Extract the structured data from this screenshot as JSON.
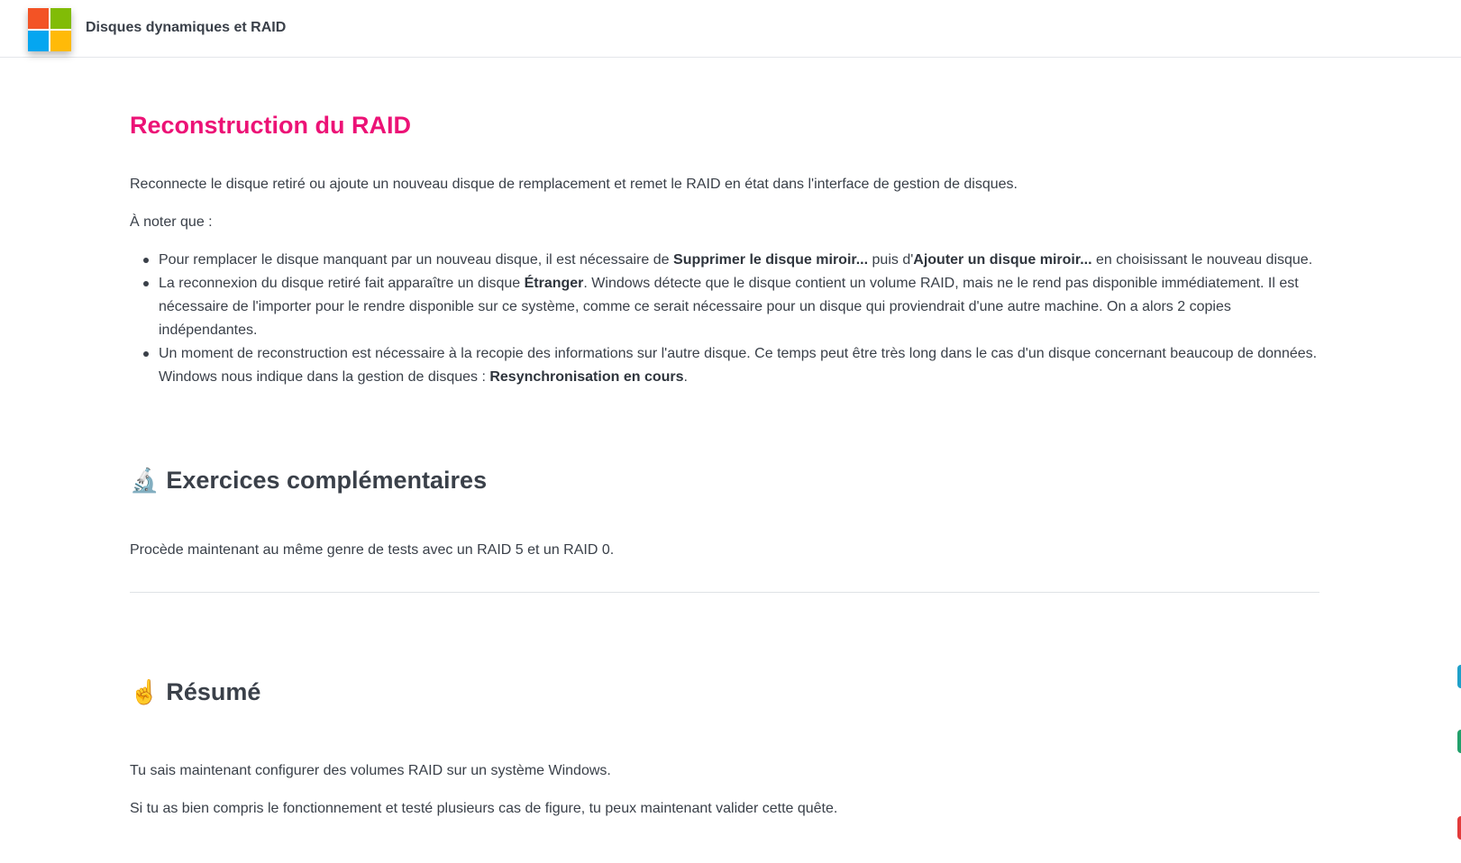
{
  "app": {
    "title": "Disques dynamiques et RAID",
    "logo_colors": [
      "#f35325",
      "#81bc06",
      "#05a6f0",
      "#ffba08"
    ]
  },
  "reconstruction": {
    "title": "Reconstruction du RAID",
    "intro": "Reconnecte le disque retiré ou ajoute un nouveau disque de remplacement et remet le RAID en état dans l'interface de gestion de disques.",
    "note_label": "À noter que :",
    "bullets": [
      {
        "t1": "Pour remplacer le disque manquant par un nouveau disque, il est nécessaire de ",
        "b1": "Supprimer le disque miroir...",
        "t2": " puis d'",
        "b2": "Ajouter un disque miroir...",
        "t3": " en choisissant le nouveau disque."
      },
      {
        "t1": "La reconnexion du disque retiré fait apparaître un disque ",
        "b1": "Étranger",
        "t2": ". Windows détecte que le disque contient un volume RAID, mais ne le rend pas disponible immédiatement. Il est nécessaire de l'importer pour le rendre disponible sur ce système, comme ce serait nécessaire pour un disque qui proviendrait d'une autre machine. On a alors 2 copies indépendantes."
      },
      {
        "t1": "Un moment de reconstruction est nécessaire à la recopie des informations sur l'autre disque. Ce temps peut être très long dans le cas d'un disque concernant beaucoup de données. Windows nous indique dans la gestion de disques : ",
        "b1": "Resynchronisation en cours",
        "t2": "."
      }
    ]
  },
  "exercices": {
    "icon": "microscope-icon",
    "emoji": "🔬",
    "title": "Exercices complémentaires",
    "text": "Procède maintenant au même genre de tests avec un RAID 5 et un RAID 0."
  },
  "resume": {
    "icon": "pointing-up-icon",
    "emoji": "☝️",
    "title": "Résumé",
    "p1": "Tu sais maintenant configurer des volumes RAID sur un système Windows.",
    "p2": "Si tu as bien compris le fonctionnement et testé plusieurs cas de figure, tu peux maintenant valider cette quête."
  },
  "colors": {
    "accent": "#ec1276",
    "text": "#3a4049"
  }
}
